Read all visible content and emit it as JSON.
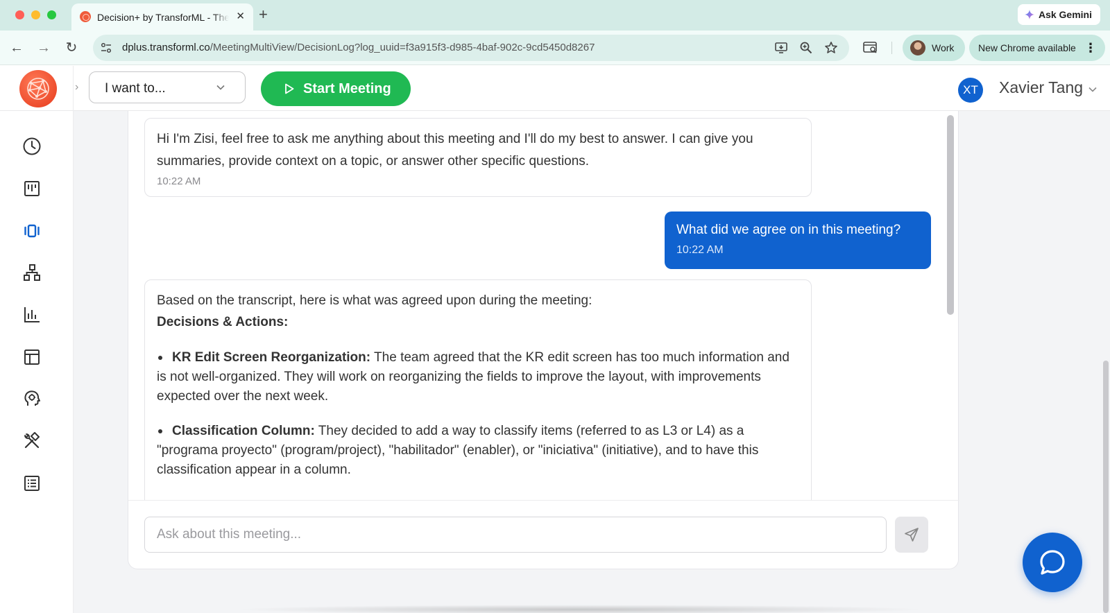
{
  "browser": {
    "tab_title": "Decision+ by TransforML - The",
    "tab_close": "✕",
    "new_tab": "+",
    "ask_gemini": "Ask Gemini",
    "url_host": "dplus.transforml.co",
    "url_path": "/MeetingMultiView/DecisionLog?log_uuid=f3a915f3-d985-4baf-902c-9cd5450d8267",
    "profile_label": "Work",
    "update_label": "New Chrome available",
    "update_menu": "⋮",
    "back": "←",
    "forward": "→",
    "reload": "↻"
  },
  "header": {
    "collapse_chevron": "›",
    "intent_select": "I want to...",
    "start_meeting": "Start Meeting",
    "user_initials": "XT",
    "user_name": "Xavier Tang"
  },
  "sidebar": {
    "icons": [
      "clock-icon",
      "kanban-icon",
      "timeline-icon",
      "hierarchy-icon",
      "bar-chart-icon",
      "table-icon",
      "ai-head-icon",
      "tools-icon",
      "list-icon"
    ]
  },
  "chat": {
    "messages": [
      {
        "role": "assistant",
        "text": "Hi I'm Zisi, feel free to ask me anything about this meeting and I'll do my best to answer. I can give you summaries, provide context on a topic, or answer other specific questions.",
        "time": "10:22 AM"
      },
      {
        "role": "user",
        "text": "What did we agree on in this meeting?",
        "time": "10:22 AM"
      },
      {
        "role": "assistant",
        "intro": "Based on the transcript, here is what was agreed upon during the meeting:",
        "heading": "Decisions & Actions:",
        "items": [
          {
            "title": "KR Edit Screen Reorganization:",
            "text": "The team agreed that the KR edit screen has too much information and is not well-organized. They will work on reorganizing the fields to improve the layout, with improvements expected over the next week."
          },
          {
            "title": "Classification Column:",
            "text": "They decided to add a way to classify items (referred to as L3 or L4) as a \"programa proyecto\" (program/project), \"habilitador\" (enabler), or \"iniciativa\" (initiative), and to have this classification appear in a column."
          }
        ]
      }
    ],
    "input_placeholder": "Ask about this meeting..."
  },
  "colors": {
    "primary_blue": "#1062cf",
    "start_green": "#20b953",
    "logo_orange": "#e63a1c"
  }
}
